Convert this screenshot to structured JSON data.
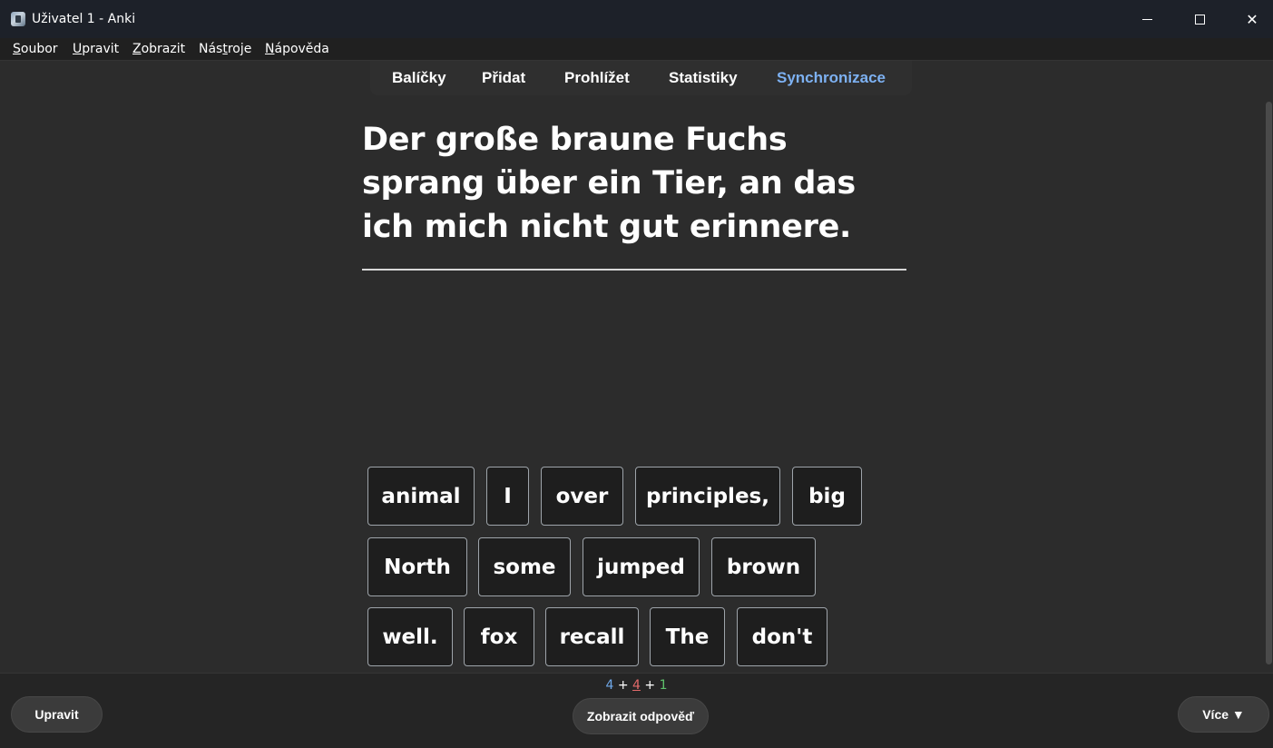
{
  "window": {
    "title": "Uživatel 1 - Anki",
    "icon": "anki-app-icon",
    "controls": {
      "minimize": "minimize-icon",
      "maximize": "maximize-icon",
      "close": "✕"
    }
  },
  "menubar": {
    "items": [
      {
        "first": "S",
        "rest": "oubor"
      },
      {
        "first": "U",
        "rest": "pravit"
      },
      {
        "first": "Z",
        "rest": "obrazit"
      },
      {
        "pre": "Nás",
        "ul": "t",
        "post": "roje"
      },
      {
        "first": "N",
        "rest": "ápověda"
      }
    ]
  },
  "toolbar": {
    "items": [
      "Balíčky",
      "Přidat",
      "Prohlížet",
      "Statistiky",
      "Synchronizace"
    ],
    "active_color": "#7db1f2"
  },
  "card": {
    "question": "Der große braune Fuchs sprang über ein Tier, an das ich mich nicht gut erinnere.",
    "word_rows": [
      [
        "animal",
        "I",
        "over",
        "principles,",
        "big"
      ],
      [
        "North",
        "some",
        "jumped",
        "brown"
      ],
      [
        "well.",
        "fox",
        "recall",
        "The",
        "don't"
      ]
    ]
  },
  "counts": {
    "new": "4",
    "learning": "4",
    "review": "1",
    "separator": "+",
    "colors": {
      "new": "#6fa9ea",
      "learning": "#e36a6a",
      "review": "#5ec06b"
    }
  },
  "bottom": {
    "edit_label": "Upravit",
    "show_answer_label": "Zobrazit odpověď",
    "more_label": "Více ▼"
  }
}
